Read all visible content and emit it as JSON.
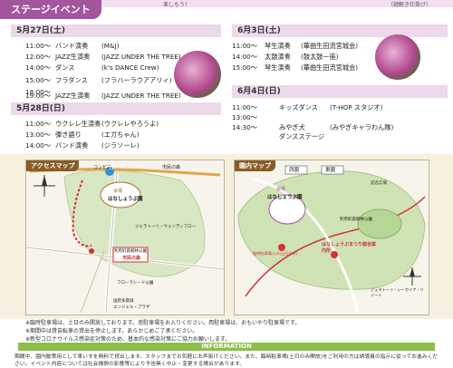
{
  "header": {
    "title": "ステージイベント",
    "snippet_center": "楽しもう！",
    "snippet_right": "（謎解き仕掛け）"
  },
  "days": [
    {
      "id": "may27",
      "label": "5月27日(土)",
      "rows": [
        {
          "time": "11:00〜",
          "program": "バンド演奏",
          "group": "(M&J)"
        },
        {
          "time": "12:00〜",
          "program": "JAZZ生演奏",
          "group": "(JAZZ UNDER THE TREE)"
        },
        {
          "time": "14:00〜",
          "program": "ダンス",
          "group": "(k's DANCE Crew)"
        },
        {
          "time": "15:00〜",
          "program": "フラダンス",
          "group": "(フラハーラウアアリィ)"
        },
        {
          "time": "18:00〜",
          "program": "",
          "group": ""
        },
        {
          "time": "19:00〜",
          "program": "JAZZ生演奏",
          "group": "(JAZZ UNDER THE TREE)"
        }
      ]
    },
    {
      "id": "may28",
      "label": "5月28日(日)",
      "rows": [
        {
          "time": "11:00〜",
          "program": "ウクレレ生演奏",
          "group": "(ウクレレやろうよ)"
        },
        {
          "time": "13:00〜",
          "program": "弾き語り",
          "group": "(エガちゃん)"
        },
        {
          "time": "14:00〜",
          "program": "バンド演奏",
          "group": "(ジラソーレ)"
        }
      ]
    },
    {
      "id": "jun3",
      "label": "6月3日(土)",
      "rows": [
        {
          "time": "11:00〜",
          "program": "琴生演奏",
          "group": "(華曲生田流宮城会)"
        },
        {
          "time": "14:00〜",
          "program": "太鼓演奏",
          "group": "(鼓太鼓一座)"
        },
        {
          "time": "15:00〜",
          "program": "琴生演奏",
          "group": "(華曲生田流宮城会)"
        }
      ]
    },
    {
      "id": "jun4",
      "label": "6月4日(日)",
      "rows": [
        {
          "time": "11:00〜",
          "program": "キッズダンス",
          "group": "(T-HOP スタジオ)"
        },
        {
          "time": "13:00〜",
          "program": "",
          "group": ""
        },
        {
          "time": "14:30〜",
          "program": "みやぎ犬",
          "program2": "ダンスステージ",
          "group": "(みやぎキャラわん隊)"
        }
      ]
    }
  ],
  "access_map": {
    "label": "アクセスマップ",
    "places": {
      "conveni": "コンビニ",
      "city_office": "市民の森",
      "kaijo": "会場",
      "park": "はなしょうぶ園",
      "route": "11",
      "forest": "利府町森郷林公園",
      "forest2": "市民の森",
      "resort": "ジェラトーリ・ウェンディフロー",
      "mall": "フローラシ－ド公園",
      "station": "国府多賀城",
      "plaza": "エンジェル・プラザ"
    }
  },
  "park_map": {
    "label": "園内マップ",
    "places": {
      "west": "西園",
      "east": "東園",
      "kaijo": "会場",
      "park": "はなしょうぶ園",
      "forest": "利府町森郷林公園",
      "info": "はなしょうぶまつり総合案内所",
      "info_sub": "臨時駐車場入口(土日のみ)",
      "resort": "ジェラトーリ・シーガイア・リゾート",
      "square": "記念広場"
    }
  },
  "notes": [
    "※臨時駐車場は、土日のみ開放しております。南駐車場をお入りください。西駐車場は、おもいやり駐車場です。",
    "※期間中は貸自転車の貸出を停止します。あらかじめご了承ください。",
    "※新型コロナウイルス感染症対策のため、基本的な感染対策にご協力お願いします。"
  ],
  "information": {
    "title": "INFORMATION",
    "text": "期間中、園内散策用として車いすを無料で貸出します。スタッフまでお気軽にお声掛けください。また、臨時駐車場(土日のみ開放)をご利用の方は誘導員の指示に従ってお進みください。イベント内容については社会情勢の影響等により予告無く中止・変更する場合があります。"
  },
  "colors": {
    "accent": "#a3559e",
    "day_bg": "#ecd9ea",
    "map_bg": "#f6f0df",
    "info_green": "#8dbf4a"
  }
}
